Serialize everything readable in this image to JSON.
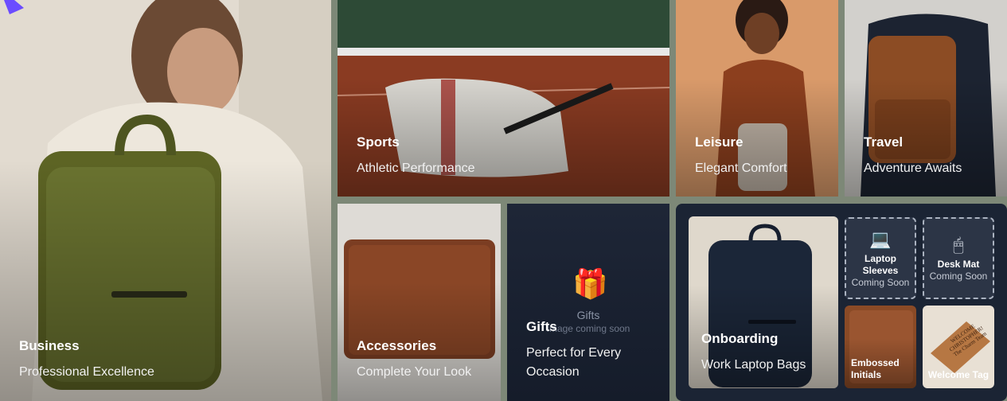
{
  "tiles": {
    "business": {
      "title": "Business",
      "subtitle": "Professional Excellence"
    },
    "sports": {
      "title": "Sports",
      "subtitle": "Athletic Performance"
    },
    "leisure": {
      "title": "Leisure",
      "subtitle": "Elegant Comfort"
    },
    "travel": {
      "title": "Travel",
      "subtitle": "Adventure Awaits"
    },
    "accessories": {
      "title": "Accessories",
      "subtitle": "Complete Your Look"
    },
    "gifts": {
      "title": "Gifts",
      "subtitle_line1": "Perfect for Every",
      "subtitle_line2": "Occasion",
      "placeholder_label": "Gifts",
      "placeholder_note": "Image coming soon",
      "icon": "gift-icon"
    },
    "onboarding": {
      "title": "Onboarding",
      "subtitle": "Work Laptop Bags",
      "items": {
        "laptop_sleeves": {
          "label_line1": "Laptop",
          "label_line2": "Sleeves",
          "status": "Coming Soon",
          "icon": "laptop-icon"
        },
        "desk_mat": {
          "label": "Desk Mat",
          "status": "Coming Soon",
          "icon": "mouse-icon"
        },
        "embossed_initials": {
          "label_line1": "Embossed",
          "label_line2": "Initials"
        },
        "welcome_tag": {
          "label": "Welcome Tag",
          "tag_text_line1": "WELCOME",
          "tag_text_line2": "CHRISTOPHER!",
          "tag_text_line3": "The Charm Team"
        }
      }
    }
  },
  "colors": {
    "background": "#7d8877",
    "navy_panel": "#1b2434",
    "accent_purple": "#6b4cff"
  }
}
